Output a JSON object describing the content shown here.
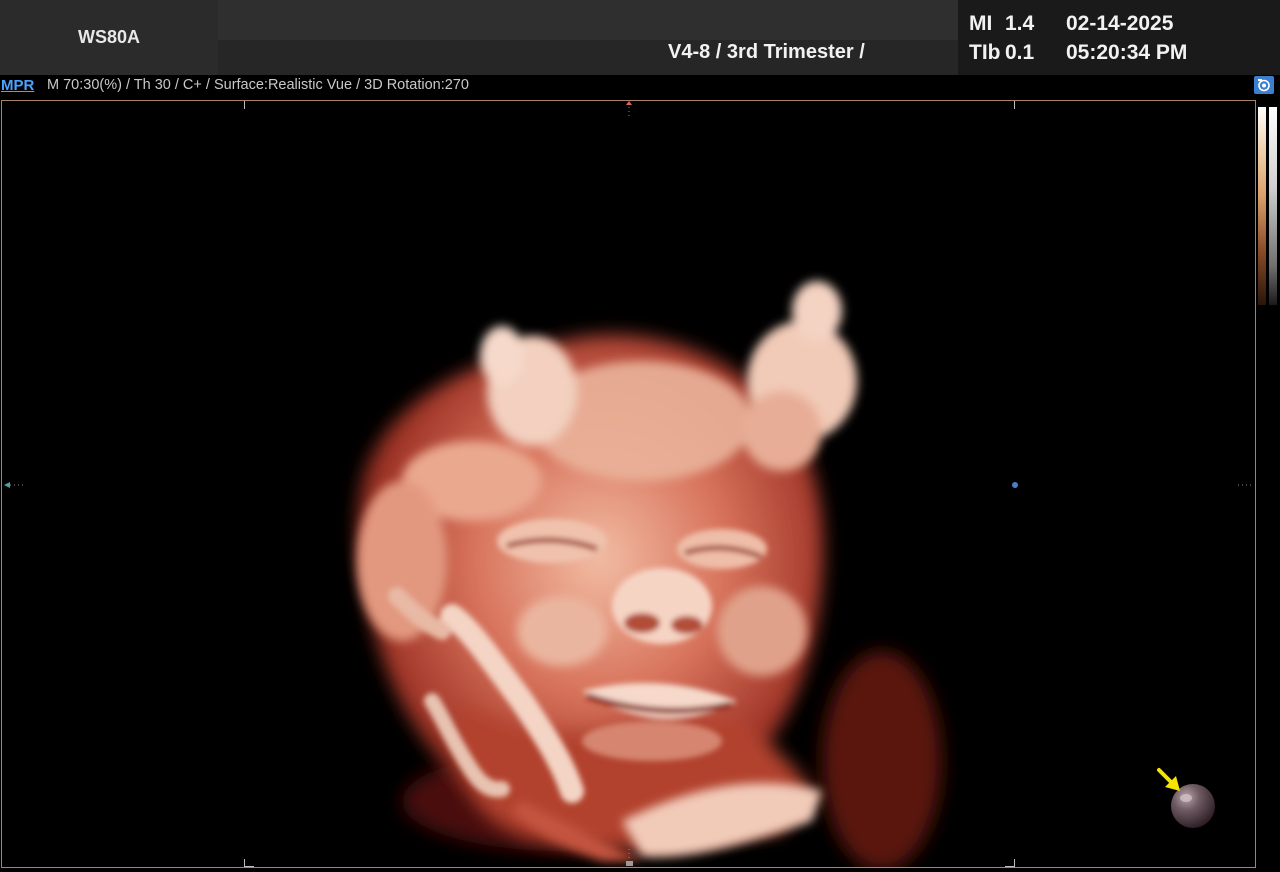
{
  "header": {
    "system_model": "WS80A",
    "probe_preset": "V4-8 / 3rd Trimester /",
    "mi_label": "MI",
    "mi_value": "1.4",
    "tib_label": "TIb",
    "tib_value": "0.1",
    "date": "02-14-2025",
    "time": "05:20:34 PM"
  },
  "infobar": {
    "mode_label": "MPR",
    "params": "M 70:30(%) / Th 30 / C+ / Surface:Realistic Vue / 3D Rotation:270"
  },
  "icons": {
    "camera": "camera-icon",
    "orientation_marker": "orientation-ball-icon",
    "arrow": "arrow-icon"
  },
  "colors": {
    "accent": "#4aa3ff",
    "skin_highlight": "#f6cdb6",
    "skin_mid": "#d5705a",
    "skin_shadow": "#7a1f14",
    "marker_yellow": "#f5e400"
  }
}
